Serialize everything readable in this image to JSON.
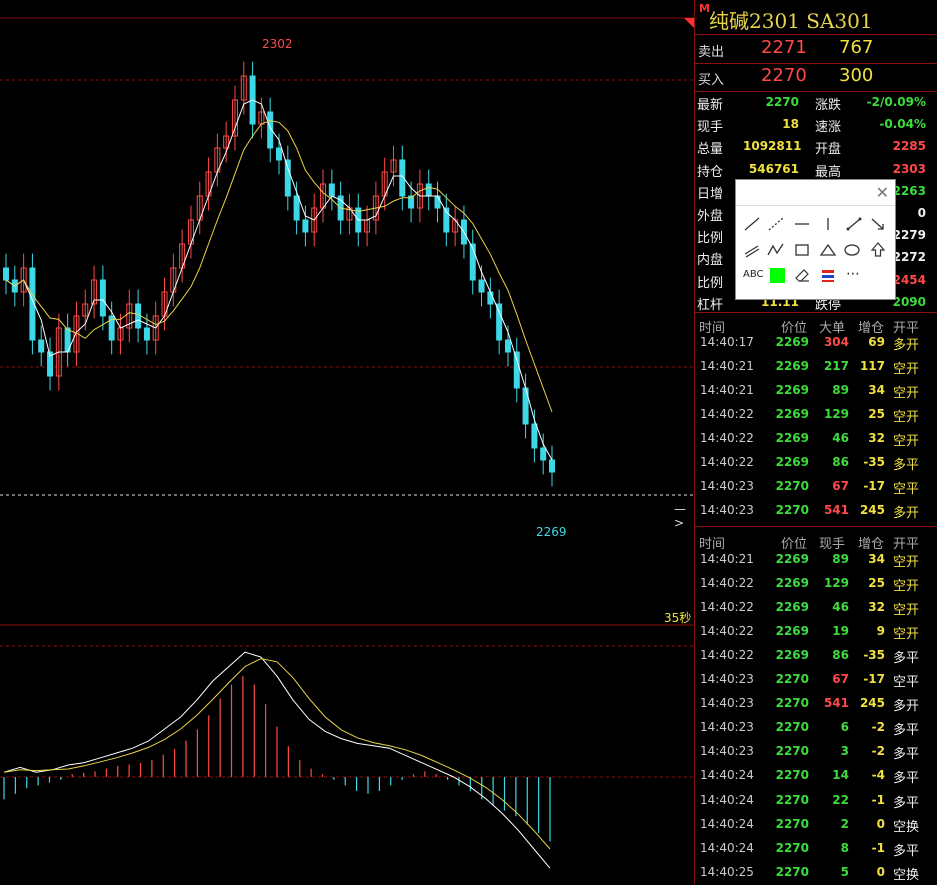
{
  "title": {
    "badge": "M",
    "text": "纯碱2301  SA301"
  },
  "ask": {
    "label": "卖出",
    "price": "2271",
    "volume": "767"
  },
  "bid": {
    "label": "买入",
    "price": "2270",
    "volume": "300"
  },
  "stats": [
    {
      "l1": "最新",
      "v1": "2270",
      "c1": "green",
      "l2": "涨跌",
      "v2": "-2/0.09%",
      "c2": "green"
    },
    {
      "l1": "现手",
      "v1": "18",
      "c1": "yellow",
      "l2": "速涨",
      "v2": "-0.04%",
      "c2": "green"
    },
    {
      "l1": "总量",
      "v1": "1092811",
      "c1": "yellow",
      "l2": "开盘",
      "v2": "2285",
      "c2": "red"
    },
    {
      "l1": "持仓",
      "v1": "546761",
      "c1": "yellow",
      "l2": "最高",
      "v2": "2303",
      "c2": "red"
    },
    {
      "l1": "日增",
      "v1": "",
      "c1": "yellow",
      "l2": "",
      "v2": "2263",
      "c2": "green"
    },
    {
      "l1": "外盘",
      "v1": "",
      "c1": "yellow",
      "l2": "",
      "v2": "0",
      "c2": "white"
    },
    {
      "l1": "比例",
      "v1": "",
      "c1": "yellow",
      "l2": "",
      "v2": "2279",
      "c2": "white"
    },
    {
      "l1": "内盘",
      "v1": "",
      "c1": "yellow",
      "l2": "",
      "v2": "2272",
      "c2": "white"
    },
    {
      "l1": "比例",
      "v1": "",
      "c1": "yellow",
      "l2": "",
      "v2": "2454",
      "c2": "red"
    },
    {
      "l1": "杠杆",
      "v1": "11.11",
      "c1": "yellow",
      "l2": "跌停",
      "v2": "2090",
      "c2": "green"
    }
  ],
  "big_orders": {
    "headers": [
      "时间",
      "价位",
      "大单",
      "增仓",
      "开平"
    ],
    "rows": [
      {
        "time": "14:40:17",
        "price": "2269",
        "vol": "304",
        "vc": "red",
        "chg": "69",
        "cc": "yellow",
        "type": "多开",
        "tc": "yellow"
      },
      {
        "time": "14:40:21",
        "price": "2269",
        "vol": "217",
        "vc": "green",
        "chg": "117",
        "cc": "yellow",
        "type": "空开",
        "tc": "yellow"
      },
      {
        "time": "14:40:21",
        "price": "2269",
        "vol": "89",
        "vc": "green",
        "chg": "34",
        "cc": "yellow",
        "type": "空开",
        "tc": "yellow"
      },
      {
        "time": "14:40:22",
        "price": "2269",
        "vol": "129",
        "vc": "green",
        "chg": "25",
        "cc": "yellow",
        "type": "空开",
        "tc": "yellow"
      },
      {
        "time": "14:40:22",
        "price": "2269",
        "vol": "46",
        "vc": "green",
        "chg": "32",
        "cc": "yellow",
        "type": "空开",
        "tc": "yellow"
      },
      {
        "time": "14:40:22",
        "price": "2269",
        "vol": "86",
        "vc": "green",
        "chg": "-35",
        "cc": "yellow",
        "type": "多平",
        "tc": "yellow"
      },
      {
        "time": "14:40:23",
        "price": "2270",
        "vol": "67",
        "vc": "red",
        "chg": "-17",
        "cc": "yellow",
        "type": "空平",
        "tc": "yellow"
      },
      {
        "time": "14:40:23",
        "price": "2270",
        "vol": "541",
        "vc": "red",
        "chg": "245",
        "cc": "yellow",
        "type": "多开",
        "tc": "yellow"
      }
    ]
  },
  "ticks": {
    "headers": [
      "时间",
      "价位",
      "现手",
      "增仓",
      "开平"
    ],
    "rows": [
      {
        "time": "14:40:21",
        "price": "2269",
        "vol": "89",
        "vc": "green",
        "chg": "34",
        "cc": "yellow",
        "type": "空开",
        "tc": "yellow"
      },
      {
        "time": "14:40:22",
        "price": "2269",
        "vol": "129",
        "vc": "green",
        "chg": "25",
        "cc": "yellow",
        "type": "空开",
        "tc": "yellow"
      },
      {
        "time": "14:40:22",
        "price": "2269",
        "vol": "46",
        "vc": "green",
        "chg": "32",
        "cc": "yellow",
        "type": "空开",
        "tc": "yellow"
      },
      {
        "time": "14:40:22",
        "price": "2269",
        "vol": "19",
        "vc": "green",
        "chg": "9",
        "cc": "yellow",
        "type": "空开",
        "tc": "yellow"
      },
      {
        "time": "14:40:22",
        "price": "2269",
        "vol": "86",
        "vc": "green",
        "chg": "-35",
        "cc": "yellow",
        "type": "多平",
        "tc": "white"
      },
      {
        "time": "14:40:23",
        "price": "2270",
        "vol": "67",
        "vc": "red",
        "chg": "-17",
        "cc": "yellow",
        "type": "空平",
        "tc": "white"
      },
      {
        "time": "14:40:23",
        "price": "2270",
        "vol": "541",
        "vc": "red",
        "chg": "245",
        "cc": "yellow",
        "type": "多开",
        "tc": "white"
      },
      {
        "time": "14:40:23",
        "price": "2270",
        "vol": "6",
        "vc": "green",
        "chg": "-2",
        "cc": "yellow",
        "type": "多平",
        "tc": "white"
      },
      {
        "time": "14:40:23",
        "price": "2270",
        "vol": "3",
        "vc": "green",
        "chg": "-2",
        "cc": "yellow",
        "type": "多平",
        "tc": "white"
      },
      {
        "time": "14:40:24",
        "price": "2270",
        "vol": "14",
        "vc": "green",
        "chg": "-4",
        "cc": "yellow",
        "type": "多平",
        "tc": "white"
      },
      {
        "time": "14:40:24",
        "price": "2270",
        "vol": "22",
        "vc": "green",
        "chg": "-1",
        "cc": "yellow",
        "type": "多平",
        "tc": "white"
      },
      {
        "time": "14:40:24",
        "price": "2270",
        "vol": "2",
        "vc": "green",
        "chg": "0",
        "cc": "yellow",
        "type": "空换",
        "tc": "white"
      },
      {
        "time": "14:40:24",
        "price": "2270",
        "vol": "8",
        "vc": "green",
        "chg": "-1",
        "cc": "yellow",
        "type": "多平",
        "tc": "white"
      },
      {
        "time": "14:40:25",
        "price": "2270",
        "vol": "5",
        "vc": "green",
        "chg": "0",
        "cc": "yellow",
        "type": "空换",
        "tc": "white"
      }
    ]
  },
  "chart": {
    "high_label": "2302",
    "low_label": "2269",
    "period_label": "35秒",
    "marker": "—>",
    "up_color": "#ff4a4a",
    "down_color": "#3cd8e8",
    "closes": [
      2285,
      2284,
      2286,
      2280,
      2279,
      2277,
      2281,
      2279,
      2282,
      2283,
      2285,
      2282,
      2280,
      2281,
      2283,
      2281,
      2280,
      2282,
      2284,
      2286,
      2288,
      2290,
      2292,
      2294,
      2296,
      2297,
      2300,
      2302,
      2298,
      2299,
      2296,
      2295,
      2292,
      2290,
      2289,
      2291,
      2293,
      2292,
      2290,
      2291,
      2289,
      2290,
      2292,
      2294,
      2295,
      2292,
      2291,
      2293,
      2292,
      2291,
      2289,
      2290,
      2288,
      2285,
      2284,
      2283,
      2280,
      2279,
      2276,
      2273,
      2271,
      2270,
      2269
    ],
    "ylim": [
      2265,
      2305
    ],
    "macd": [
      -0.8,
      -0.6,
      -0.4,
      -0.3,
      -0.2,
      -0.1,
      0.1,
      0.15,
      0.2,
      0.3,
      0.4,
      0.45,
      0.5,
      0.6,
      0.8,
      1.0,
      1.3,
      1.7,
      2.2,
      2.8,
      3.3,
      3.6,
      3.3,
      2.6,
      1.8,
      1.1,
      0.6,
      0.3,
      0.1,
      -0.1,
      -0.3,
      -0.5,
      -0.6,
      -0.5,
      -0.3,
      -0.1,
      0.1,
      0.2,
      0.1,
      -0.1,
      -0.3,
      -0.5,
      -0.8,
      -1.0,
      -1.2,
      -1.4,
      -1.7,
      -2.0,
      -2.3
    ],
    "dif": [
      0.2,
      0.4,
      0.2,
      0.3,
      0.5,
      0.6,
      0.8,
      1.0,
      1.2,
      1.5,
      2.0,
      2.5,
      3.2,
      4.0,
      4.6,
      5.2,
      5.0,
      4.2,
      3.2,
      2.4,
      1.9,
      1.6,
      1.4,
      1.3,
      1.2,
      0.9,
      0.6,
      0.3,
      0.0,
      -0.4,
      -0.9,
      -1.5,
      -2.2,
      -3.0,
      -3.8
    ]
  }
}
